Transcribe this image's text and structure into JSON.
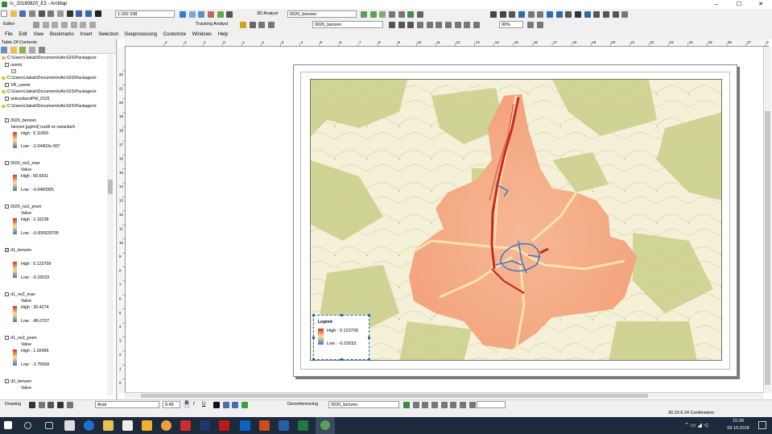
{
  "window": {
    "title": "rs_20180820_E3 - ArcMap",
    "min": "–",
    "max": "☐",
    "close": "✕"
  },
  "toolbar": {
    "scale": "1:292 338",
    "analyst_3d": "3D Analyst",
    "layer_3d": "0020_benzen",
    "editor": "Editor",
    "tracking_analyst": "Tracking Analyst",
    "layer_main": "0020_benzen",
    "zoom": "90%"
  },
  "menu": [
    "File",
    "Edit",
    "View",
    "Bookmarks",
    "Insert",
    "Selection",
    "Geoprocessing",
    "Customize",
    "Windows",
    "Help"
  ],
  "toc": {
    "title": "Table Of Contents",
    "items": [
      {
        "type": "folder",
        "label": "C:\\Users\\Jakub\\Documents\\ArcGIS\\Packages\\r"
      },
      {
        "type": "layer",
        "label": "uzemi"
      },
      {
        "type": "folder",
        "label": "C:\\Users\\Jakub\\Documents\\ArcGIS\\Packages\\r"
      },
      {
        "type": "layer",
        "label": "VR_uzemi"
      },
      {
        "type": "folder",
        "label": "C:\\Users\\Jakub\\Documents\\ArcGIS\\Packages\\r"
      },
      {
        "type": "layer",
        "label": "sekundarniPM_2015"
      },
      {
        "type": "folder",
        "label": "C:\\Users\\Jakub\\Documents\\ArcGIS\\Packages\\r"
      },
      {
        "type": "layer",
        "label": "0020_benzen",
        "sub": "benzen [µg/m3] rozdíl ve variantách",
        "high": "High : 0.11059",
        "low": "Low : -2.04402e-007"
      },
      {
        "type": "layer",
        "label": "0020_no2_max",
        "sub": "Value",
        "high": "High : 60.6911",
        "low": "Low : -0.0483955"
      },
      {
        "type": "layer",
        "label": "0020_no2_prum",
        "sub": "Value",
        "high": "High : 2.16238",
        "low": "Low : -0.000929705"
      },
      {
        "type": "layer",
        "label": "d1_benzen",
        "sub": "",
        "high": "High : 0.123709",
        "low": "Low : -0.15033",
        "checked": true
      },
      {
        "type": "layer",
        "label": "d1_no2_max",
        "sub": "Value",
        "high": "High : 36.4274",
        "low": "Low : -86.0707"
      },
      {
        "type": "layer",
        "label": "d1_no2_prum",
        "sub": "Value",
        "high": "High : 1.02495",
        "low": "Low : -2.75558"
      },
      {
        "type": "layer",
        "label": "d2_benzen",
        "sub": "Value"
      }
    ]
  },
  "ruler": {
    "h": [
      "3",
      "2",
      "1",
      "0",
      "1",
      "2",
      "3",
      "4",
      "5",
      "6",
      "7",
      "8",
      "9",
      "10",
      "11",
      "12",
      "13",
      "14",
      "15",
      "16",
      "17",
      "18",
      "19",
      "20",
      "21",
      "22",
      "23",
      "24",
      "25",
      "26",
      "27",
      "28"
    ],
    "v": [
      "22",
      "21",
      "20",
      "19",
      "18",
      "17",
      "16",
      "15",
      "14",
      "13",
      "12",
      "11",
      "10",
      "9",
      "8",
      "7",
      "6",
      "5",
      "4",
      "3",
      "2",
      "1",
      "0"
    ]
  },
  "legend": {
    "title": "Legend",
    "high": "High : 0.123709",
    "low": "Low : -0.15033"
  },
  "drawbar": {
    "drawing": "Drawing",
    "font": "Arial",
    "size": "8.49",
    "bold": "B",
    "italic": "I",
    "underline": "U",
    "georef": "Georeferencing",
    "georef_layer": "0020_benzen"
  },
  "status": {
    "coords": "30.20  6.24 Centimeters"
  },
  "taskbar": {
    "time": "15:28",
    "date": "09.10.2018"
  },
  "colors": {
    "high": "#d73027",
    "low": "#4575b4",
    "mid": "#f4a582"
  }
}
